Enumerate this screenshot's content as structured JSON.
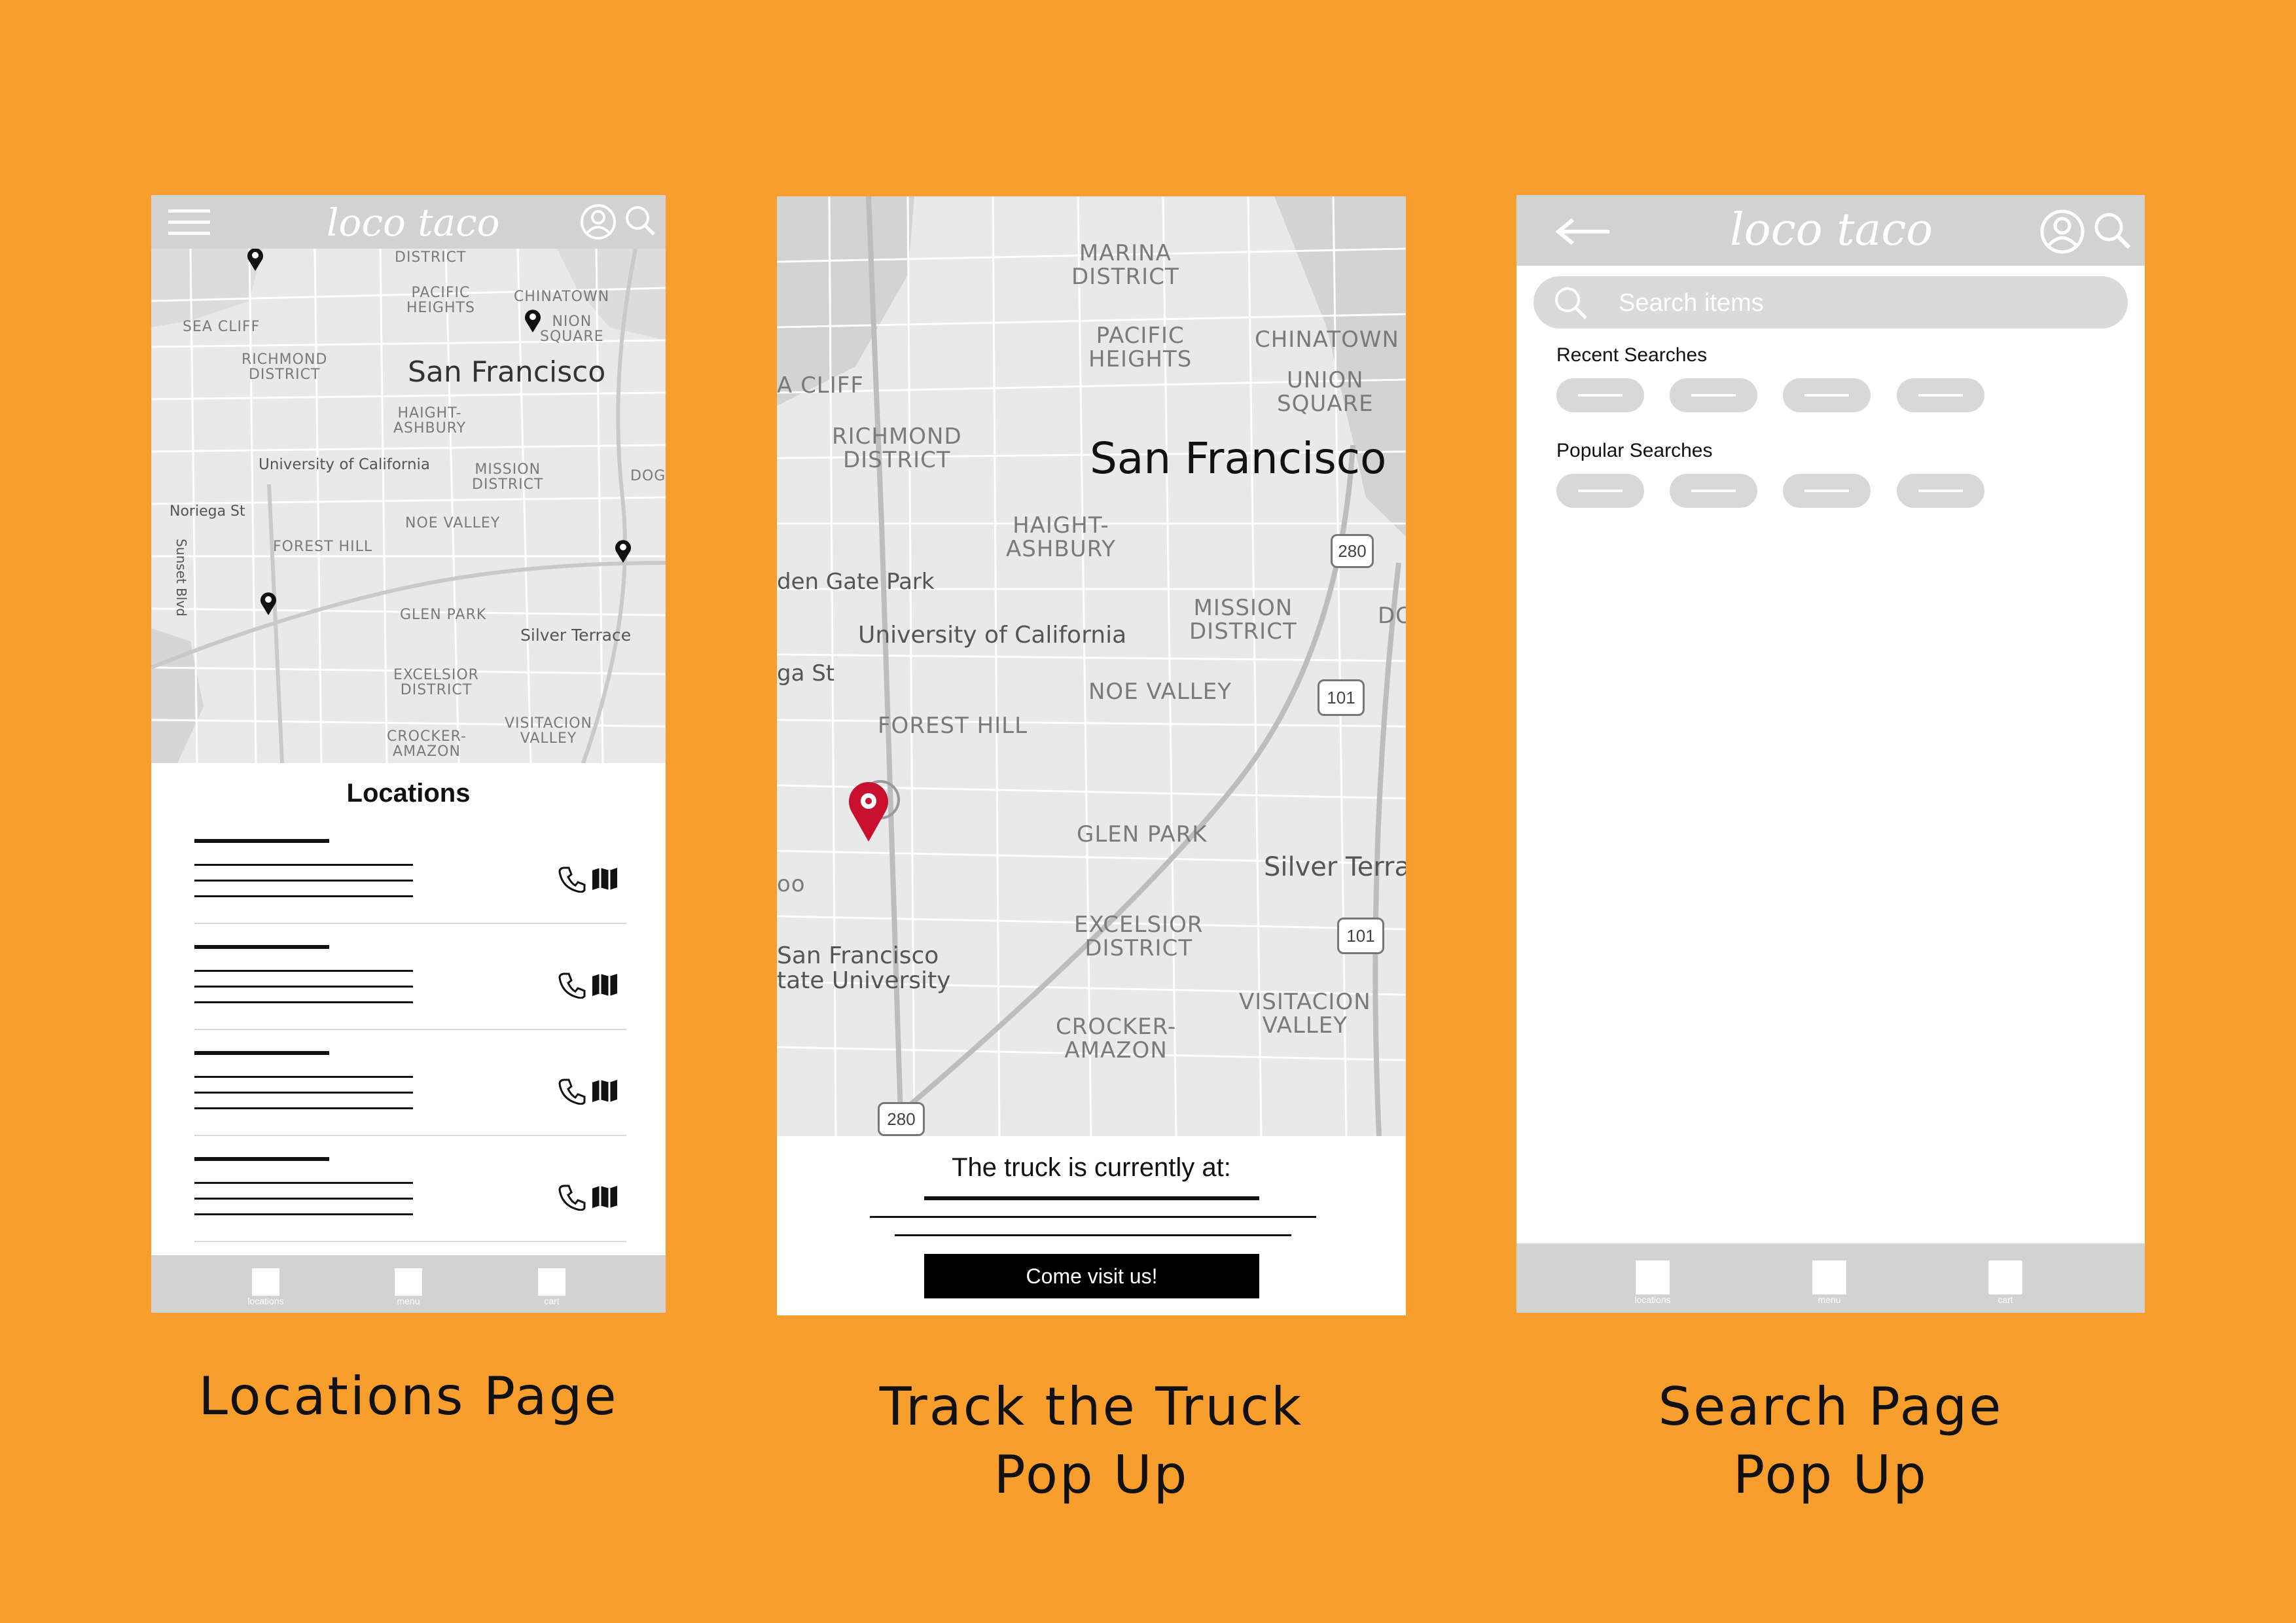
{
  "app": {
    "logo": "loco taco"
  },
  "captions": {
    "locations": "Locations Page",
    "track_line1": "Track the Truck",
    "track_line2": "Pop Up",
    "search_line1": "Search Page",
    "search_line2": "Pop Up"
  },
  "bottom_nav": [
    "locations",
    "menu",
    "cart"
  ],
  "map_labels": {
    "district_top": "DISTRICT",
    "sea_cliff": "SEA CLIFF",
    "a_cliff": "A CLIFF",
    "pacific_heights": "PACIFIC\nHEIGHTS",
    "chinatown": "CHINATOWN",
    "union_square": "UNION\nSQUARE",
    "nion_square": "NION\nSQUARE",
    "marina": "MARINA\nDISTRICT",
    "richmond": "RICHMOND\nDISTRICT",
    "san_francisco": "San Francisco",
    "haight": "HAIGHT-\nASHBURY",
    "university": "University of California",
    "mission": "MISSION\nDISTRICT",
    "dogpatch": "DOGPATC",
    "do": "DO",
    "noriega": "Noriega St",
    "ga_st": "ga St",
    "sunset": "Sunset Blvd",
    "noe_valley": "NOE VALLEY",
    "forest_hill": "FOREST HILL",
    "glen_park": "GLEN PARK",
    "silver_terrace": "Silver Terrace",
    "silver_terra": "Silver Terra",
    "excelsior": "EXCELSIOR\nDISTRICT",
    "crocker": "CROCKER-\nAMAZON",
    "visitacion": "VISITACION\nVALLEY",
    "golden_gate": "den Gate Park",
    "sfsu": "San Francisco\ntate University",
    "oo": "oo",
    "hwy_280": "280",
    "hwy_101": "101"
  },
  "locations_page": {
    "heading": "Locations",
    "row_count": 4
  },
  "track_popup": {
    "message": "The truck is currently at:",
    "button": "Come visit us!"
  },
  "search_page": {
    "placeholder": "Search items",
    "recent_title": "Recent Searches",
    "popular_title": "Popular Searches"
  },
  "colors": {
    "background": "#F79E2C",
    "bar_gray": "#D2D2D2",
    "pin_red": "#C8102E"
  }
}
